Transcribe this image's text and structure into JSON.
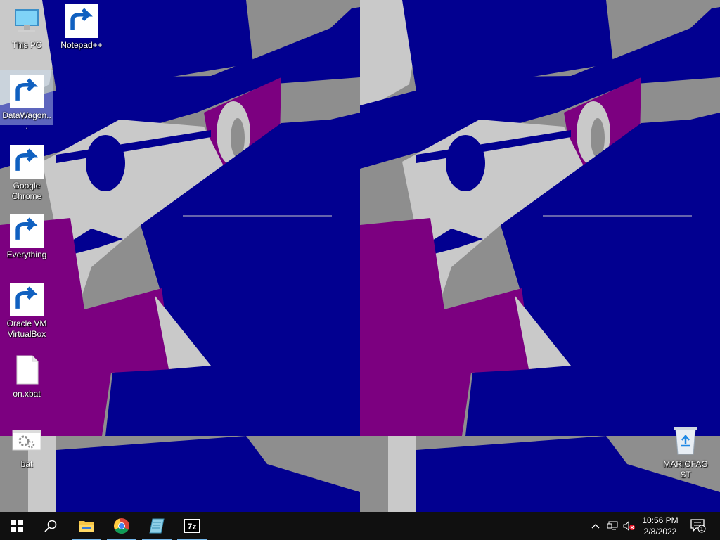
{
  "desktop": {
    "icons": [
      {
        "label": "This PC",
        "icon": "computer-icon"
      },
      {
        "label": "DataWagon...",
        "icon": "datawagon-icon"
      },
      {
        "label": "Google Chrome",
        "icon": "chrome-icon"
      },
      {
        "label": "Everything",
        "icon": "everything-search-icon"
      },
      {
        "label": "Oracle VM VirtualBox",
        "icon": "virtualbox-icon"
      },
      {
        "label": "on.xbat",
        "icon": "blank-file-icon"
      },
      {
        "label": "bat",
        "icon": "batch-file-icon"
      },
      {
        "label": "Notepad++",
        "icon": "notepad-plus-plus-icon"
      },
      {
        "label": "MARIOFAG ST",
        "icon": "recycle-bin-icon"
      }
    ]
  },
  "taskbar": {
    "start": "windows-logo-icon",
    "search": "search-icon",
    "pinned": [
      {
        "name": "File Explorer",
        "icon": "folder-icon",
        "running": true
      },
      {
        "name": "Google Chrome",
        "icon": "chrome-icon",
        "running": true
      },
      {
        "name": "Notepad",
        "icon": "notepad-icon",
        "running": true
      },
      {
        "name": "7-Zip",
        "icon": "7zip-icon",
        "running": true
      }
    ],
    "tray": {
      "icons": [
        "chevron-up-icon",
        "network-icon",
        "volume-muted-icon"
      ],
      "time": "10:56 PM",
      "date": "2/8/2022",
      "notification_count": "1"
    }
  },
  "colors": {
    "wallpaper_blue": "#020090",
    "wallpaper_purple": "#7c0080",
    "wallpaper_light": "#c9c9c9",
    "wallpaper_gray": "#8e8e8e",
    "taskbar": "#101010",
    "accent": "#76b9ed"
  }
}
